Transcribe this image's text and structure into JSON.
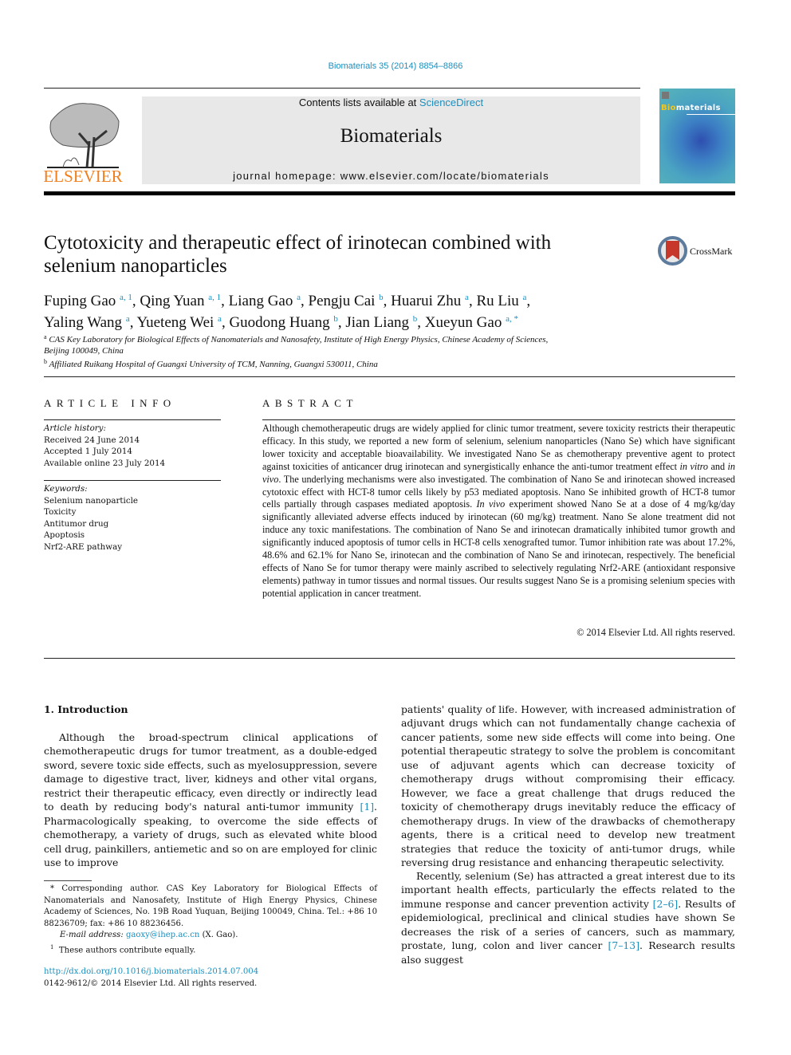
{
  "header": {
    "citation": "Biomaterials 35 (2014) 8854–8866",
    "contents_prefix": "Contents lists available at ",
    "contents_link": "ScienceDirect",
    "journal_name": "Biomaterials",
    "homepage": "journal homepage: www.elsevier.com/locate/biomaterials",
    "publisher_logo": "ELSEVIER",
    "cover_title_highlight": "Bio",
    "cover_title_rest": "materials",
    "crossmark_label": "CrossMark"
  },
  "colors": {
    "link": "#1a8fbf",
    "elsevier_orange": "#f07f1d",
    "banner_bg": "#e8e8e8",
    "crossmark_red": "#c8382a"
  },
  "article": {
    "title_line1": "Cytotoxicity and therapeutic effect of irinotecan combined with",
    "title_line2": "selenium nanoparticles",
    "authors_line1": [
      {
        "name": "Fuping Gao",
        "sup": "a, 1",
        "sep": ", "
      },
      {
        "name": "Qing Yuan",
        "sup": "a, 1",
        "sep": ", "
      },
      {
        "name": "Liang Gao",
        "sup": "a",
        "sep": ", "
      },
      {
        "name": "Pengju Cai",
        "sup": "b",
        "sep": ", "
      },
      {
        "name": "Huarui Zhu",
        "sup": "a",
        "sep": ", "
      },
      {
        "name": "Ru Liu",
        "sup": "a",
        "sep": ","
      }
    ],
    "authors_line2": [
      {
        "name": "Yaling Wang",
        "sup": "a",
        "sep": ", "
      },
      {
        "name": "Yueteng Wei",
        "sup": "a",
        "sep": ", "
      },
      {
        "name": "Guodong Huang",
        "sup": "b",
        "sep": ", "
      },
      {
        "name": "Jian Liang",
        "sup": "b",
        "sep": ", "
      },
      {
        "name": "Xueyun Gao",
        "sup": "a, *",
        "sep": ""
      }
    ],
    "affiliations": [
      {
        "mark": "a",
        "text": "CAS Key Laboratory for Biological Effects of Nanomaterials and Nanosafety, Institute of High Energy Physics, Chinese Academy of Sciences,",
        "text2": "Beijing 100049, China"
      },
      {
        "mark": "b",
        "text": "Affiliated Ruikang Hospital of Guangxi University of TCM, Nanning, Guangxi 530011, China",
        "text2": ""
      }
    ]
  },
  "article_info": {
    "heading": "ARTICLE INFO",
    "history_label": "Article history:",
    "history": [
      "Received 24 June 2014",
      "Accepted 1 July 2014",
      "Available online 23 July 2014"
    ],
    "keywords_label": "Keywords:",
    "keywords": [
      "Selenium nanoparticle",
      "Toxicity",
      "Antitumor drug",
      "Apoptosis",
      "Nrf2-ARE pathway"
    ]
  },
  "abstract": {
    "heading": "ABSTRACT",
    "p1": "Although chemotherapeutic drugs are widely applied for clinic tumor treatment, severe toxicity restricts their therapeutic efficacy. In this study, we reported a new form of selenium, selenium nanoparticles (Nano Se) which have significant lower toxicity and acceptable bioavailability. We investigated Nano Se as chemotherapy preventive agent to protect against toxicities of anticancer drug irinotecan and synergistically enhance the anti-tumor treatment effect ",
    "i1": "in vitro",
    "p2": " and ",
    "i2": "in vivo",
    "p3": ". The underlying mechanisms were also investigated. The combination of Nano Se and irinotecan showed increased cytotoxic effect with HCT-8 tumor cells likely by p53 mediated apoptosis. Nano Se inhibited growth of HCT-8 tumor cells partially through caspases mediated apoptosis. ",
    "i3": "In vivo",
    "p4": " experiment showed Nano Se at a dose of 4 mg/kg/day significantly alleviated adverse effects induced by irinotecan (60 mg/kg) treatment. Nano Se alone treatment did not induce any toxic manifestations. The combination of Nano Se and irinotecan dramatically inhibited tumor growth and significantly induced apoptosis of tumor cells in HCT-8 cells xenografted tumor. Tumor inhibition rate was about 17.2%, 48.6% and 62.1% for Nano Se, irinotecan and the combination of Nano Se and irinotecan, respectively. The beneficial effects of Nano Se for tumor therapy were mainly ascribed to selectively regulating Nrf2-ARE (antioxidant responsive elements) pathway in tumor tissues and normal tissues. Our results suggest Nano Se is a promising selenium species with potential application in cancer treatment.",
    "copyright": "© 2014 Elsevier Ltd. All rights reserved."
  },
  "body": {
    "intro_heading": "1.  Introduction",
    "left_p1a": "Although the broad-spectrum clinical applications of chemotherapeutic drugs for tumor treatment, as a double-edged sword, severe toxic side effects, such as myelosuppression, severe damage to digestive tract, liver, kidneys and other vital organs, restrict their therapeutic efficacy, even directly or indirectly lead to death by reducing body's natural anti-tumor immunity ",
    "left_ref1": "[1]",
    "left_p1b": ". Pharmacologically speaking, to overcome the side effects of chemotherapy, a variety of drugs, such as elevated white blood cell drug, painkillers, antiemetic and so on are employed for clinic use to improve",
    "right_p1": "patients' quality of life. However, with increased administration of adjuvant drugs which can not fundamentally change cachexia of cancer patients, some new side effects will come into being. One potential therapeutic strategy to solve the problem is concomitant use of adjuvant agents which can decrease toxicity of chemotherapy drugs without compromising their efficacy. However, we face a great challenge that drugs reduced the toxicity of chemotherapy drugs inevitably reduce the efficacy of chemotherapy drugs. In view of the drawbacks of chemotherapy agents, there is a critical need to develop new treatment strategies that reduce the toxicity of anti-tumor drugs, while reversing drug resistance and enhancing therapeutic selectivity.",
    "right_p2a": "Recently, selenium (Se) has attracted a great interest due to its important health effects, particularly the effects related to the immune response and cancer prevention activity ",
    "right_ref2": "[2–6]",
    "right_p2b": ". Results of epidemiological, preclinical and clinical studies have shown Se decreases the risk of a series of cancers, such as mammary, prostate, lung, colon and liver cancer ",
    "right_ref3": "[7–13]",
    "right_p2c": ". Research results also suggest"
  },
  "footnotes": {
    "corresponding": "* Corresponding author. CAS Key Laboratory for Biological Effects of Nanomaterials and Nanosafety, Institute of High Energy Physics, Chinese Academy of Sciences, No. 19B Road Yuquan, Beijing 100049, China. Tel.: +86 10 88236709; fax: +86 10 88236456.",
    "email_label": "E-mail address: ",
    "email": "gaoxy@ihep.ac.cn",
    "email_suffix": " (X. Gao).",
    "equal_mark": "1",
    "equal": "These authors contribute equally.",
    "doi": "http://dx.doi.org/10.1016/j.biomaterials.2014.07.004",
    "issn": "0142-9612/© 2014 Elsevier Ltd. All rights reserved."
  }
}
